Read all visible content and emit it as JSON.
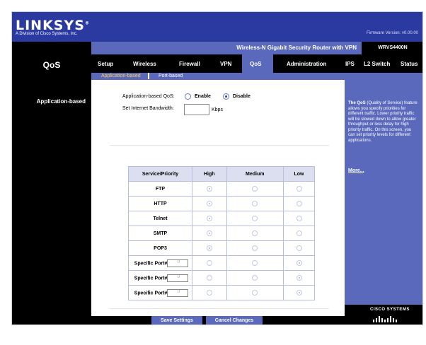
{
  "header": {
    "logo": "LINKSYS",
    "logo_registered": "®",
    "logo_sub": "A Division of Cisco Systems, Inc.",
    "firmware": "Firmware Version: v0.00.00"
  },
  "product": {
    "name": "Wireless-N Gigabit Security Router with VPN",
    "model": "WRVS4400N"
  },
  "section_title": "QoS",
  "nav": {
    "tabs": [
      "Setup",
      "Wireless",
      "Firewall",
      "VPN",
      "QoS",
      "Administration",
      "IPS",
      "L2 Switch",
      "Status"
    ],
    "active": "QoS"
  },
  "subnav": {
    "items": [
      "Application-based",
      "Port-based"
    ],
    "active": "Application-based"
  },
  "left_label": "Application-based",
  "form": {
    "qos_label": "Application-based QoS:",
    "enable_label": "Enable",
    "disable_label": "Disable",
    "selected": "Disable",
    "bandwidth_label": "Set Internet Bandwidth:",
    "bandwidth_value": "",
    "bandwidth_unit": "Kbps"
  },
  "table": {
    "headers": [
      "Service/Priority",
      "High",
      "Medium",
      "Low"
    ],
    "rows": [
      {
        "service": "FTP",
        "priority": "High"
      },
      {
        "service": "HTTP",
        "priority": "High"
      },
      {
        "service": "Telnet",
        "priority": "High"
      },
      {
        "service": "SMTP",
        "priority": "High"
      },
      {
        "service": "POP3",
        "priority": "High"
      },
      {
        "service": "Specific Port#",
        "port": "0",
        "priority": "Low"
      },
      {
        "service": "Specific Port#",
        "port": "0",
        "priority": "Low"
      },
      {
        "service": "Specific Port#",
        "port": "0",
        "priority": "Low"
      }
    ]
  },
  "help": {
    "lead": "The QoS",
    "text": " (Quality of Service) feature allows you specify priorities for different traffic. Lower priority traffic will be slowed down to allow greater throughput or less delay for high priority traffic. On this screen, you can set priority levels for different applications.",
    "more": "More..."
  },
  "footer": {
    "save": "Save Settings",
    "cancel": "Cancel Changes",
    "cisco": "CISCO SYSTEMS"
  },
  "colors": {
    "brand": "#2b3aa0",
    "accent": "#5a69bb",
    "black": "#000000",
    "subnav_active": "#ffd24a"
  }
}
